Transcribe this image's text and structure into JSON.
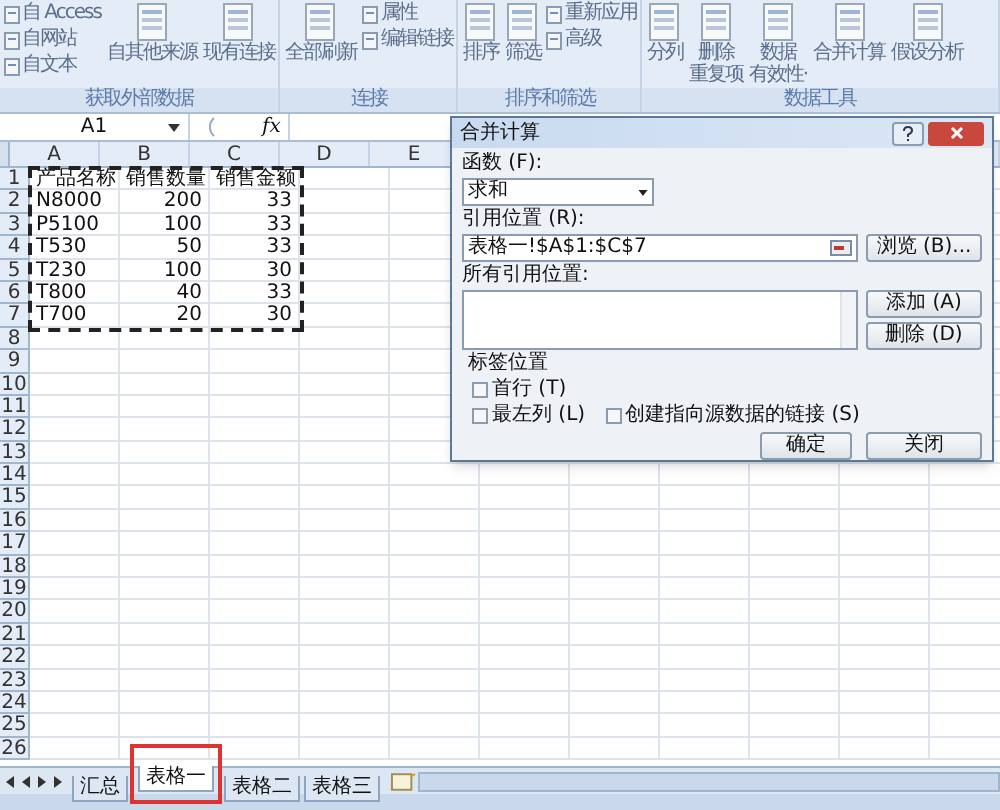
{
  "ribbon": {
    "groups": [
      {
        "label": "获取外部数据",
        "columns": [
          [
            {
              "label": [
                "自 Access"
              ],
              "kind": "small"
            },
            {
              "label": [
                "自网站"
              ],
              "kind": "small"
            },
            {
              "label": [
                "自文本"
              ],
              "kind": "small"
            }
          ],
          [
            {
              "label": [
                "自其他来源"
              ],
              "kind": "large"
            }
          ],
          [
            {
              "label": [
                "现有连接"
              ],
              "kind": "large"
            }
          ]
        ]
      },
      {
        "label": "连接",
        "columns": [
          [
            {
              "label": [
                "全部刷新"
              ],
              "kind": "large"
            }
          ],
          [
            {
              "label": [
                "属性"
              ],
              "kind": "small"
            },
            {
              "label": [
                "编辑链接"
              ],
              "kind": "small"
            }
          ]
        ]
      },
      {
        "label": "排序和筛选",
        "columns": [
          [
            {
              "label": [
                "排序"
              ],
              "kind": "large"
            }
          ],
          [
            {
              "label": [
                "筛选"
              ],
              "kind": "large"
            }
          ],
          [
            {
              "label": [
                "重新应用"
              ],
              "kind": "small"
            },
            {
              "label": [
                "高级"
              ],
              "kind": "small"
            }
          ]
        ]
      },
      {
        "label": "数据工具",
        "columns": [
          [
            {
              "label": [
                "分列"
              ],
              "kind": "large"
            }
          ],
          [
            {
              "label": [
                "删除",
                "重复项"
              ],
              "kind": "large"
            }
          ],
          [
            {
              "label": [
                "数据",
                "有效性·"
              ],
              "kind": "large"
            }
          ],
          [
            {
              "label": [
                "合并计算"
              ],
              "kind": "large"
            }
          ],
          [
            {
              "label": [
                "假设分析"
              ],
              "kind": "large"
            }
          ]
        ]
      }
    ]
  },
  "formula_bar": {
    "name_box": "A1",
    "fx": "fx"
  },
  "sheet": {
    "columns": [
      "A",
      "B",
      "C",
      "D",
      "E"
    ],
    "row_numbers": [
      "1",
      "2",
      "3",
      "4",
      "5",
      "6",
      "7",
      "8",
      "9",
      "10",
      "11",
      "12",
      "13",
      "14",
      "15",
      "16",
      "17",
      "18",
      "19",
      "20",
      "21",
      "22",
      "23",
      "24",
      "25",
      "26"
    ],
    "rows": [
      [
        "产品名称",
        "销售数量",
        "销售金额"
      ],
      [
        "N8000",
        "200",
        "33"
      ],
      [
        "P5100",
        "100",
        "33"
      ],
      [
        "T530",
        "50",
        "33"
      ],
      [
        "T230",
        "100",
        "30"
      ],
      [
        "T800",
        "40",
        "33"
      ],
      [
        "T700",
        "20",
        "30"
      ]
    ]
  },
  "dialog": {
    "title": "合并计算",
    "function_label": "函数 (F):",
    "function_value": "求和",
    "reference_label": "引用位置 (R):",
    "reference_value": "表格一!$A$1:$C$7",
    "browse_button": "浏览 (B)...",
    "all_references_label": "所有引用位置:",
    "add_button": "添加 (A)",
    "delete_button": "删除 (D)",
    "label_group": "标签位置",
    "checkboxes": [
      {
        "label": "首行 (T)",
        "checked": false
      },
      {
        "label": "最左列 (L)",
        "checked": false
      },
      {
        "label": "创建指向源数据的链接 (S)",
        "checked": false
      }
    ],
    "ok_button": "确定",
    "close_button": "关闭"
  },
  "sheet_tabs": [
    {
      "label": "汇总",
      "selected": false,
      "highlighted": false
    },
    {
      "label": "表格一",
      "selected": true,
      "highlighted": true
    },
    {
      "label": "表格二",
      "selected": false,
      "highlighted": false
    },
    {
      "label": "表格三",
      "selected": false,
      "highlighted": false
    }
  ]
}
